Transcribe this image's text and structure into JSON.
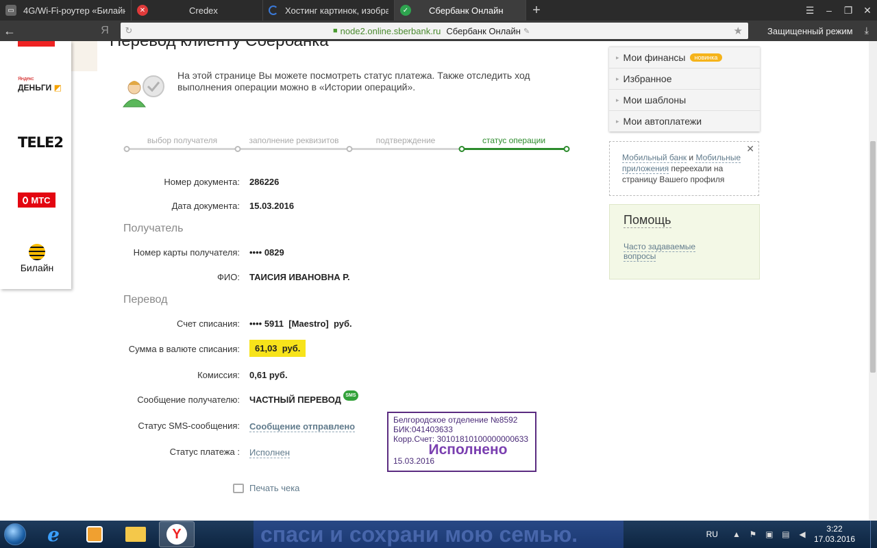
{
  "browser": {
    "tabs": [
      {
        "label": "4G/Wi-Fi-роутер «Билайн»",
        "icon": "router-icon",
        "color": "#666666"
      },
      {
        "label": "Credex",
        "icon": "credex-icon",
        "color": "#e03a3a"
      },
      {
        "label": "Хостинг картинок, изображе",
        "icon": "loading-spinner-icon",
        "color": "#3a7ad9"
      },
      {
        "label": "Сбербанк Онлайн",
        "icon": "sberbank-icon",
        "color": "#2ea44f"
      }
    ],
    "new_tab": "+",
    "back": "←",
    "yandex_mark": "Я",
    "url_host": "node2.online.sberbank.ru",
    "url_title": "Сбербанк Онлайн",
    "protected_mode": "Защищенный режим"
  },
  "page": {
    "title": "Перевод клиенту Сбербанка",
    "info_text": "На этой странице Вы можете посмотреть статус платежа. Также отследить ход выполнения операции можно в «Истории операций».",
    "steps": [
      {
        "label": "выбор получателя",
        "active": false
      },
      {
        "label": "заполнение реквизитов",
        "active": false
      },
      {
        "label": "подтверждение",
        "active": false
      },
      {
        "label": "статус операции",
        "active": true
      }
    ],
    "fields": {
      "doc_number_label": "Номер документа:",
      "doc_number": "286226",
      "doc_date_label": "Дата документа:",
      "doc_date": "15.03.2016",
      "recipient_section": "Получатель",
      "card_label": "Номер карты получателя:",
      "card": "•••• 0829",
      "name_label": "ФИО:",
      "name": "ТАИСИЯ ИВАНОВНА Р.",
      "transfer_section": "Перевод",
      "account_label": "Счет списания:",
      "account": "•••• 5911  [Maestro]  руб.",
      "amount_label": "Сумма в валюте списания:",
      "amount": "61,03  руб.",
      "fee_label": "Комиссия:",
      "fee": "0,61 руб.",
      "message_label": "Сообщение получателю:",
      "message": "ЧАСТНЫЙ ПЕРЕВОД",
      "sms_badge": "SMS",
      "sms_status_label": "Статус SMS-сообщения:",
      "sms_status": "Сообщение отправлено",
      "pay_status_label": "Статус платежа :",
      "pay_status": "Исполнен"
    },
    "stamp": {
      "branch": "Белгородское отделение №8592",
      "bik": "БИК:041403633",
      "corr": "Корр.Счет: 30101810100000000633",
      "status": "Исполнено",
      "date": "15.03.2016"
    },
    "print_label": "Печать чека"
  },
  "partners": {
    "yandex_top": "Яндекс",
    "yandex_bottom": "ДЕНЬГИ",
    "tele2": "TELE2",
    "mts": "МТС",
    "beeline": "Билайн"
  },
  "sidebar": {
    "menu": [
      {
        "label": "Мои финансы",
        "badge": "новинка"
      },
      {
        "label": "Избранное"
      },
      {
        "label": "Мои шаблоны"
      },
      {
        "label": "Мои автоплатежи"
      }
    ],
    "notice": {
      "link1": "Мобильный банк",
      "and": " и ",
      "link2": "Мобильные приложения",
      "rest": " переехали на страницу Вашего профиля"
    },
    "help_title": "Помощь",
    "help_link": "Часто задаваемые вопросы"
  },
  "taskbar": {
    "banner": "спаси и сохрани мою семью.",
    "lang": "RU",
    "time": "3:22",
    "date": "17.03.2016"
  }
}
